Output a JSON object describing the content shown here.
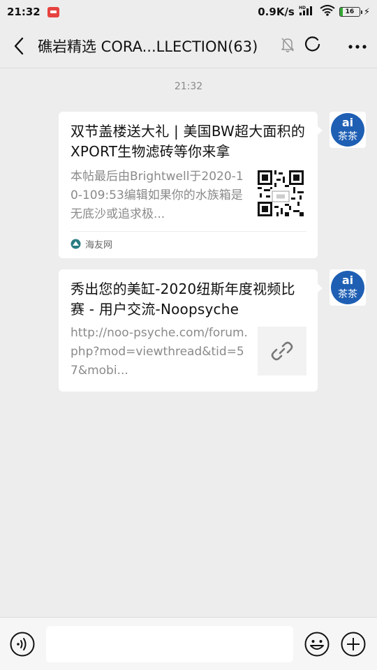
{
  "status_bar": {
    "time": "21:32",
    "network_speed": "0.9K/s",
    "hd_label": "HD",
    "battery_level": "16"
  },
  "header": {
    "title": "礁岩精选 CORA...LLECTION(63)",
    "icons": [
      "back-arrow",
      "mute-bell",
      "circle-status",
      "more-dots"
    ]
  },
  "chat": {
    "timestamp": "21:32",
    "messages": [
      {
        "title": "双节盖楼送大礼 | 美国BW超大面积的XPORT生物滤砖等你来拿",
        "description": "本帖最后由Brightwell于2020-10-109:53编辑如果你的水族箱是无底沙或追求极...",
        "source": "海友网",
        "thumbnail": "qr-code",
        "avatar_text": "ai\n茶茶"
      },
      {
        "title": "秀出您的美缸-2020纽斯年度视频比赛 - 用户交流-Noopsyche",
        "description": "http://noo-psyche.com/forum.php?mod=viewthread&tid=57&mobi...",
        "thumbnail": "link-icon",
        "avatar_text": "ai\n茶茶"
      }
    ]
  },
  "bottom_bar": {
    "input_value": "",
    "icons": [
      "voice-icon",
      "emoji-icon",
      "plus-icon"
    ]
  },
  "colors": {
    "background": "#ededed",
    "card": "#ffffff",
    "avatar_blue": "#1e5fb4"
  }
}
